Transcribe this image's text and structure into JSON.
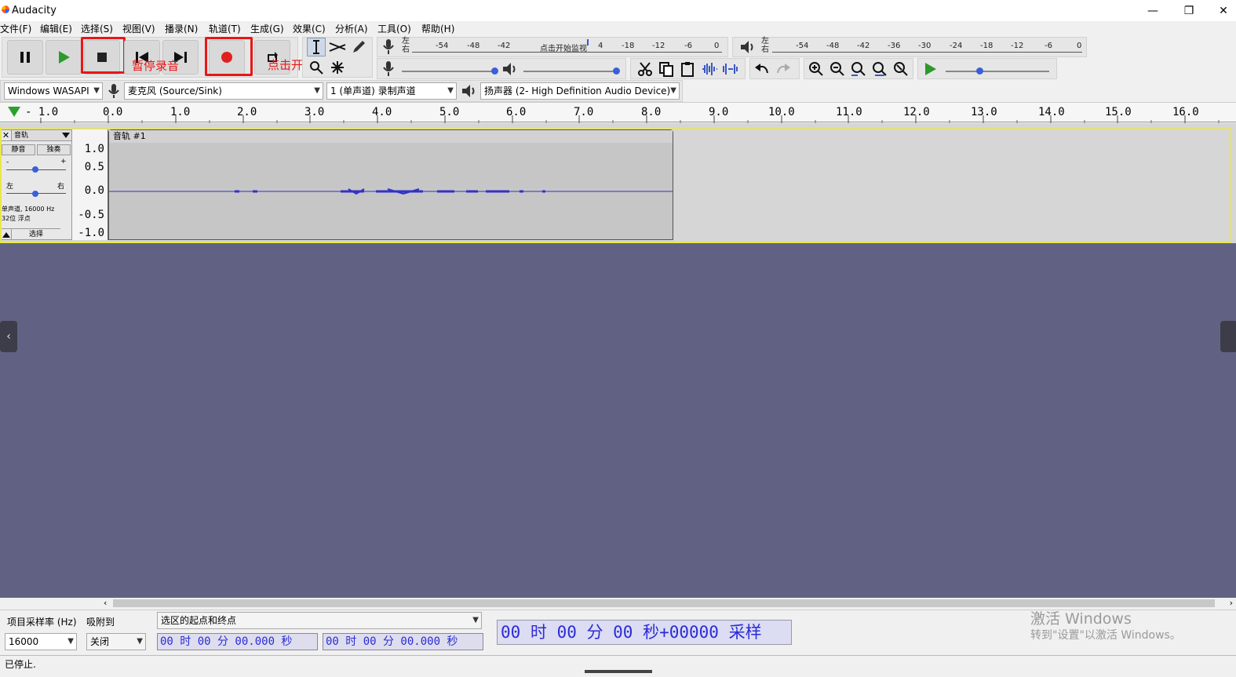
{
  "window": {
    "title": "Audacity",
    "minimize": "—",
    "maximize": "❐",
    "close": "✕"
  },
  "menu": [
    {
      "label": "文件(F)"
    },
    {
      "label": "编辑(E)"
    },
    {
      "label": "选择(S)"
    },
    {
      "label": "视图(V)"
    },
    {
      "label": "播录(N)"
    },
    {
      "label": "轨道(T)"
    },
    {
      "label": "生成(G)"
    },
    {
      "label": "效果(C)"
    },
    {
      "label": "分析(A)"
    },
    {
      "label": "工具(O)"
    },
    {
      "label": "帮助(H)"
    }
  ],
  "annotations": {
    "stop": "暂停录音",
    "record": "点击开始录音"
  },
  "record_meter": {
    "lr_top": "左",
    "lr_bottom": "右",
    "ticks": [
      "-54",
      "-48",
      "-42",
      "点击开始监视",
      "4",
      "-18",
      "-12",
      "-6",
      "0"
    ]
  },
  "play_meter": {
    "lr_top": "左",
    "lr_bottom": "右",
    "ticks": [
      "-54",
      "-48",
      "-42",
      "-36",
      "-30",
      "-24",
      "-18",
      "-12",
      "-6",
      "0"
    ]
  },
  "device": {
    "host": "Windows WASAPI",
    "mic": "麦克风 (Source/Sink)",
    "channels": "1 (单声道) 录制声道",
    "speaker": "扬声器 (2- High Definition Audio Device)"
  },
  "ruler": {
    "labels": [
      "- 1.0",
      "0.0",
      "1.0",
      "2.0",
      "3.0",
      "4.0",
      "5.0",
      "6.0",
      "7.0",
      "8.0",
      "9.0",
      "10.0",
      "11.0",
      "12.0",
      "13.0",
      "14.0",
      "15.0",
      "16.0"
    ]
  },
  "track": {
    "name": "音轨",
    "mute": "静音",
    "solo": "独奏",
    "gain_minus": "-",
    "gain_plus": "+",
    "pan_left": "左",
    "pan_right": "右",
    "info1": "单声道, 16000 Hz",
    "info2": "32位 浮点",
    "select": "选择",
    "clip_name": "音轨 #1",
    "scale": [
      "1.0",
      "0.5",
      "0.0",
      "-0.5",
      "-1.0"
    ]
  },
  "selection_toolbar": {
    "rate_label": "项目采样率 (Hz)",
    "rate_value": "16000",
    "snap_label": "吸附到",
    "snap_value": "关闭",
    "mode_value": "选区的起点和终点",
    "start_time": "00 时 00 分 00.000 秒",
    "end_time": "00 时 00 分 00.000 秒",
    "big_time": "00 时 00 分 00 秒+00000 采样"
  },
  "watermark": {
    "line1": "激活 Windows",
    "line2": "转到\"设置\"以激活 Windows。"
  },
  "status": {
    "text": "已停止."
  },
  "colors": {
    "record_red": "#e81616",
    "track_bg": "#616283",
    "waveform": "#3232c8",
    "annotation": "#e81616"
  }
}
